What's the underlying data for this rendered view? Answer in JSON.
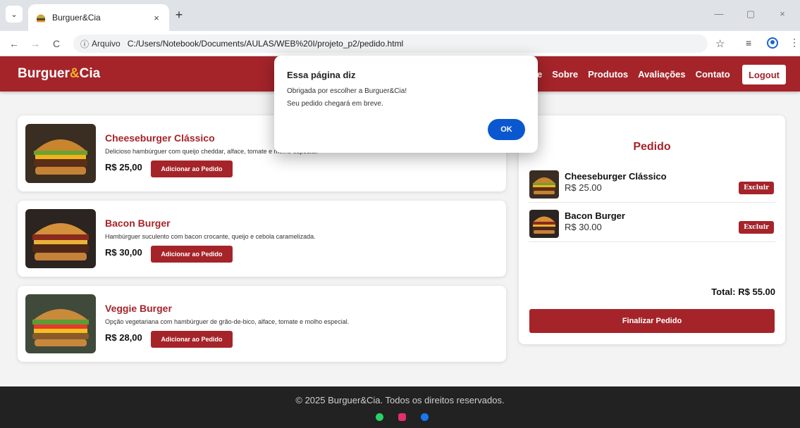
{
  "browser": {
    "tab_title": "Burguer&Cia",
    "tab_close": "×",
    "new_tab": "+",
    "window_minimize": "—",
    "window_maximize": "▢",
    "window_close": "×",
    "back_glyph": "←",
    "forward_glyph": "→",
    "reload_glyph": "C",
    "info_glyph": "ⓘ",
    "scheme_label": "Arquivo",
    "url": "C:/Users/Notebook/Documents/AULAS/WEB%20I/projeto_p2/pedido.html",
    "star_glyph": "☆",
    "media_glyph": "≡",
    "menu_glyph": "⋮",
    "tab_menu_glyph": "⌄"
  },
  "navbar": {
    "brand_part1": "Burguer",
    "brand_amp": "&",
    "brand_part2": "Cia",
    "links": [
      "e",
      "Sobre",
      "Produtos",
      "Avaliações",
      "Contato"
    ],
    "logout_label": "Logout"
  },
  "products": [
    {
      "name": "Cheeseburger Clássico",
      "description": "Delicioso hambúrguer com queijo cheddar, alface, tomate e molho especial.",
      "price": "R$ 25,00",
      "button_label": "Adicionar ao Pedido"
    },
    {
      "name": "Bacon Burger",
      "description": "Hambúrguer suculento com bacon crocante, queijo e cebola caramelizada.",
      "price": "R$ 30,00",
      "button_label": "Adicionar ao Pedido"
    },
    {
      "name": "Veggie Burger",
      "description": "Opção vegetariana com hambúrguer de grão-de-bico, alface, tomate e molho especial.",
      "price": "R$ 28,00",
      "button_label": "Adicionar ao Pedido"
    }
  ],
  "order": {
    "title": "Pedido",
    "items": [
      {
        "name": "Cheeseburger Clássico",
        "price": "R$ 25.00",
        "delete_label": "Excluir"
      },
      {
        "name": "Bacon Burger",
        "price": "R$ 30.00",
        "delete_label": "Excluir"
      }
    ],
    "total": "Total: R$ 55.00",
    "finish_label": "Finalizar Pedido"
  },
  "footer": {
    "text": "© 2025 Burguer&Cia. Todos os direitos reservados."
  },
  "dialog": {
    "title": "Essa página diz",
    "line1": "Obrigada por escolher a Burguer&Cia!",
    "line2": "Seu pedido chegará em breve.",
    "ok_label": "OK"
  },
  "colors": {
    "brand_red": "#a5242a",
    "brand_amber": "#f1b12a",
    "dialog_button": "#0b57d0"
  }
}
